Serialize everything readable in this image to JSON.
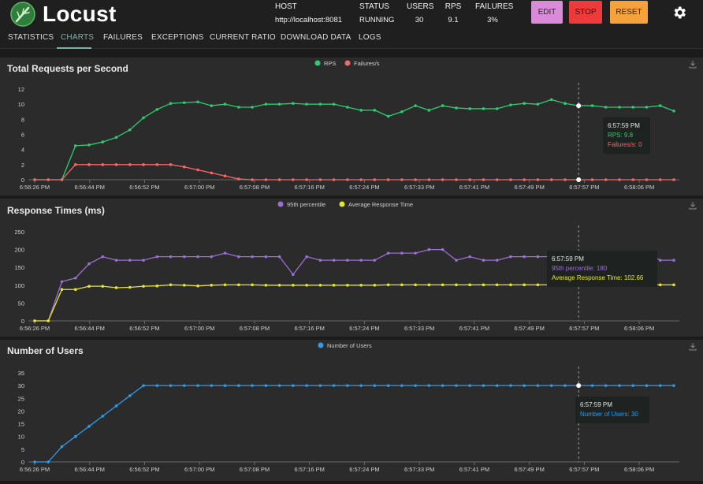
{
  "header": {
    "app_name": "Locust",
    "stats": [
      {
        "label": "HOST",
        "value": "http://localhost:8081"
      },
      {
        "label": "STATUS",
        "value": "RUNNING"
      },
      {
        "label": "USERS",
        "value": "30"
      },
      {
        "label": "RPS",
        "value": "9.1"
      },
      {
        "label": "FAILURES",
        "value": "3%"
      }
    ],
    "buttons": {
      "edit": "EDIT",
      "stop": "STOP",
      "reset": "RESET"
    },
    "colors": {
      "edit": "#d98ad8",
      "stop": "#ee3a3a",
      "reset": "#f6a23a"
    }
  },
  "tabs": [
    {
      "label": "STATISTICS",
      "active": false
    },
    {
      "label": "CHARTS",
      "active": true
    },
    {
      "label": "FAILURES",
      "active": false
    },
    {
      "label": "EXCEPTIONS",
      "active": false
    },
    {
      "label": "CURRENT RATIO",
      "active": false
    },
    {
      "label": "DOWNLOAD DATA",
      "active": false
    },
    {
      "label": "LOGS",
      "active": false
    }
  ],
  "chart_data": [
    {
      "type": "line",
      "title": "Total Requests per Second",
      "x_ticks": [
        "6:56:26 PM",
        "6:56:44 PM",
        "6:56:52 PM",
        "6:57:00 PM",
        "6:57:08 PM",
        "6:57:16 PM",
        "6:57:24 PM",
        "6:57:33 PM",
        "6:57:41 PM",
        "6:57:49 PM",
        "6:57:57 PM",
        "6:58:06 PM"
      ],
      "ylim": [
        0,
        12
      ],
      "y_ticks": [
        0,
        2,
        4,
        6,
        8,
        10,
        12
      ],
      "series": [
        {
          "name": "RPS",
          "color": "#2ecc71",
          "values": [
            0,
            0,
            0,
            4.5,
            4.6,
            5,
            5.6,
            6.6,
            8.2,
            9.3,
            10.1,
            10.2,
            10.3,
            9.8,
            10,
            9.6,
            9.6,
            10,
            10,
            10.1,
            10,
            10,
            10,
            9.6,
            9.2,
            9.2,
            8.4,
            9,
            9.8,
            9.2,
            9.8,
            9.5,
            9.4,
            9.4,
            9.4,
            9.9,
            10.1,
            10,
            10.6,
            10.1,
            9.8,
            9.8,
            9.6,
            9.6,
            9.6,
            9.6,
            9.8,
            9.1
          ]
        },
        {
          "name": "Failures/s",
          "color": "#f26a6a",
          "values": [
            0,
            0,
            0,
            2,
            2,
            2,
            2,
            2,
            2,
            2,
            2,
            1.7,
            1.3,
            0.9,
            0.5,
            0.1,
            0,
            0,
            0,
            0,
            0,
            0,
            0,
            0,
            0,
            0,
            0,
            0,
            0,
            0,
            0,
            0,
            0,
            0,
            0,
            0,
            0,
            0,
            0,
            0,
            0,
            0,
            0,
            0,
            0,
            0,
            0,
            0
          ]
        }
      ],
      "tooltip": {
        "time": "6:57:59 PM",
        "lines": [
          "RPS: 9.8",
          "Failures/s: 0"
        ]
      }
    },
    {
      "type": "line",
      "title": "Response Times (ms)",
      "x_ticks": [
        "6:56:26 PM",
        "6:56:44 PM",
        "6:56:52 PM",
        "6:57:00 PM",
        "6:57:08 PM",
        "6:57:16 PM",
        "6:57:24 PM",
        "6:57:33 PM",
        "6:57:41 PM",
        "6:57:49 PM",
        "6:57:57 PM",
        "6:58:06 PM"
      ],
      "ylim": [
        0,
        250
      ],
      "y_ticks": [
        0,
        50,
        100,
        150,
        200,
        250
      ],
      "series": [
        {
          "name": "95th percentile",
          "color": "#9b6fd4",
          "values": [
            0,
            0,
            110,
            120,
            160,
            180,
            170,
            170,
            170,
            180,
            180,
            180,
            180,
            180,
            190,
            180,
            180,
            180,
            180,
            130,
            180,
            170,
            170,
            170,
            170,
            170,
            190,
            190,
            190,
            200,
            200,
            170,
            180,
            170,
            170,
            180,
            180,
            180,
            180,
            180,
            180,
            180,
            180,
            180,
            180,
            190,
            170,
            170
          ]
        },
        {
          "name": "Average Response Time",
          "color": "#e6e62e",
          "values": [
            0,
            0,
            88,
            88,
            97,
            97,
            93,
            94,
            97,
            98,
            101,
            100,
            98,
            100,
            101,
            101,
            101,
            100,
            100,
            100,
            100,
            100,
            100,
            100,
            100,
            100,
            101,
            101,
            101,
            101,
            101,
            101,
            101,
            101,
            101,
            101,
            101,
            101,
            101,
            101,
            102.66,
            101,
            101,
            101,
            101,
            101,
            101,
            101
          ]
        }
      ],
      "tooltip": {
        "time": "6:57:59 PM",
        "lines": [
          "95th percentile: 180",
          "Average Response Time: 102.66"
        ]
      }
    },
    {
      "type": "line",
      "title": "Number of Users",
      "x_ticks": [
        "6:56:26 PM",
        "6:56:44 PM",
        "6:56:52 PM",
        "6:57:00 PM",
        "6:57:08 PM",
        "6:57:16 PM",
        "6:57:24 PM",
        "6:57:33 PM",
        "6:57:41 PM",
        "6:57:49 PM",
        "6:57:57 PM",
        "6:58:06 PM"
      ],
      "ylim": [
        0,
        35
      ],
      "y_ticks": [
        0,
        5,
        10,
        15,
        20,
        25,
        30,
        35
      ],
      "series": [
        {
          "name": "Number of Users",
          "color": "#2b9cf0",
          "values": [
            0,
            0,
            6,
            10,
            14,
            18,
            22,
            26,
            30,
            30,
            30,
            30,
            30,
            30,
            30,
            30,
            30,
            30,
            30,
            30,
            30,
            30,
            30,
            30,
            30,
            30,
            30,
            30,
            30,
            30,
            30,
            30,
            30,
            30,
            30,
            30,
            30,
            30,
            30,
            30,
            30,
            30,
            30,
            30,
            30,
            30,
            30,
            30
          ]
        }
      ],
      "tooltip": {
        "time": "6:57:59 PM",
        "lines": [
          "Number of Users: 30"
        ]
      }
    }
  ]
}
